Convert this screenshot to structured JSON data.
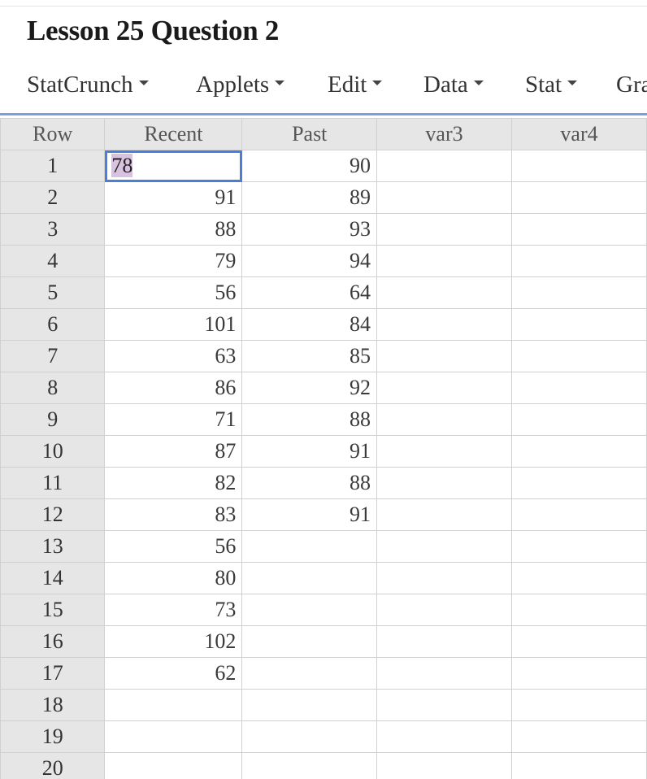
{
  "title": "Lesson 25 Question 2",
  "menu": [
    {
      "label": "StatCrunch"
    },
    {
      "label": "Applets"
    },
    {
      "label": "Edit"
    },
    {
      "label": "Data"
    },
    {
      "label": "Stat"
    },
    {
      "label": "Gra"
    }
  ],
  "grid": {
    "headers": [
      "Row",
      "Recent",
      "Past",
      "var3",
      "var4"
    ],
    "selected_cell": {
      "row": "1",
      "column": "Recent",
      "value": "78"
    },
    "rows": [
      {
        "row": "1",
        "recent": "78",
        "past": "90",
        "var3": "",
        "var4": ""
      },
      {
        "row": "2",
        "recent": "91",
        "past": "89",
        "var3": "",
        "var4": ""
      },
      {
        "row": "3",
        "recent": "88",
        "past": "93",
        "var3": "",
        "var4": ""
      },
      {
        "row": "4",
        "recent": "79",
        "past": "94",
        "var3": "",
        "var4": ""
      },
      {
        "row": "5",
        "recent": "56",
        "past": "64",
        "var3": "",
        "var4": ""
      },
      {
        "row": "6",
        "recent": "101",
        "past": "84",
        "var3": "",
        "var4": ""
      },
      {
        "row": "7",
        "recent": "63",
        "past": "85",
        "var3": "",
        "var4": ""
      },
      {
        "row": "8",
        "recent": "86",
        "past": "92",
        "var3": "",
        "var4": ""
      },
      {
        "row": "9",
        "recent": "71",
        "past": "88",
        "var3": "",
        "var4": ""
      },
      {
        "row": "10",
        "recent": "87",
        "past": "91",
        "var3": "",
        "var4": ""
      },
      {
        "row": "11",
        "recent": "82",
        "past": "88",
        "var3": "",
        "var4": ""
      },
      {
        "row": "12",
        "recent": "83",
        "past": "91",
        "var3": "",
        "var4": ""
      },
      {
        "row": "13",
        "recent": "56",
        "past": "",
        "var3": "",
        "var4": ""
      },
      {
        "row": "14",
        "recent": "80",
        "past": "",
        "var3": "",
        "var4": ""
      },
      {
        "row": "15",
        "recent": "73",
        "past": "",
        "var3": "",
        "var4": ""
      },
      {
        "row": "16",
        "recent": "102",
        "past": "",
        "var3": "",
        "var4": ""
      },
      {
        "row": "17",
        "recent": "62",
        "past": "",
        "var3": "",
        "var4": ""
      },
      {
        "row": "18",
        "recent": "",
        "past": "",
        "var3": "",
        "var4": ""
      },
      {
        "row": "19",
        "recent": "",
        "past": "",
        "var3": "",
        "var4": ""
      },
      {
        "row": "20",
        "recent": "",
        "past": "",
        "var3": "",
        "var4": ""
      }
    ]
  }
}
